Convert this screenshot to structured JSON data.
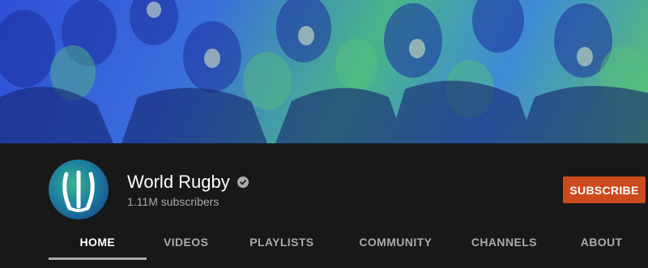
{
  "channel": {
    "name": "World Rugby",
    "subscribers": "1.11M subscribers",
    "subscribe_label": "SUBSCRIBE"
  },
  "tabs": [
    {
      "label": "HOME",
      "active": true
    },
    {
      "label": "VIDEOS",
      "active": false
    },
    {
      "label": "PLAYLISTS",
      "active": false
    },
    {
      "label": "COMMUNITY",
      "active": false
    },
    {
      "label": "CHANNELS",
      "active": false
    },
    {
      "label": "ABOUT",
      "active": false
    }
  ],
  "colors": {
    "background": "#181818",
    "subscribe": "#cc4a1e",
    "banner_blue": "#2e4fd6",
    "banner_green": "#59c46b"
  },
  "icons": {
    "verified": "verified-check-icon",
    "logo": "world-rugby-logo-icon"
  }
}
